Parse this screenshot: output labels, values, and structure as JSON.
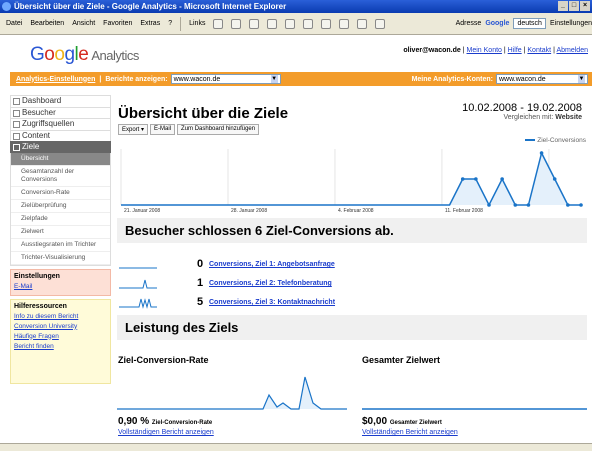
{
  "window": {
    "title": "Übersicht über die Ziele - Google Analytics - Microsoft Internet Explorer"
  },
  "menu": {
    "items": [
      "Datei",
      "Bearbeiten",
      "Ansicht",
      "Favoriten",
      "Extras",
      "?"
    ],
    "links_label": "Links",
    "address_label": "Adresse",
    "google_label": "Google",
    "google_field": "deutsch",
    "settings_label": "Einstellungen"
  },
  "header": {
    "logo_word": "Google",
    "logo_product": "Analytics",
    "user_email": "oliver@wacon.de",
    "links": [
      "Mein Konto",
      "Hilfe",
      "Kontakt",
      "Abmelden"
    ]
  },
  "orangebar": {
    "settings_link": "Analytics-Einstellungen",
    "reports_label": "Berichte anzeigen:",
    "reports_value": "www.wacon.de",
    "konten_label": "Meine Analytics-Konten:",
    "konten_value": "www.wacon.de"
  },
  "sidebar": {
    "items": [
      {
        "label": "Dashboard"
      },
      {
        "label": "Besucher"
      },
      {
        "label": "Zugriffsquellen"
      },
      {
        "label": "Content"
      },
      {
        "label": "Ziele"
      }
    ],
    "subitems": [
      "Übersicht",
      "Gesamtanzahl der Conversions",
      "Conversion-Rate",
      "Zielüberprüfung",
      "Zielpfade",
      "Zielwert",
      "Ausstiegsraten im Trichter",
      "Trichter-Visualisierung"
    ],
    "einst_title": "Einstellungen",
    "einst_link": "E-Mail",
    "hilfe_title": "Hilferessourcen",
    "hilfe_links": [
      "Info zu diesem Bericht",
      "Conversion University",
      "Häufige Fragen",
      "Bericht finden"
    ]
  },
  "main": {
    "title": "Übersicht über die Ziele",
    "date_range": "10.02.2008 - 19.02.2008",
    "compare_label": "Vergleichen mit:",
    "compare_value": "Website",
    "buttons": [
      "Export ▾",
      "E-Mail",
      "Zum Dashboard hinzufügen"
    ],
    "summary": "Besucher schlossen 6 Ziel-Conversions ab.",
    "leistung": "Leistung des Ziels",
    "rate_title": "Ziel-Conversion-Rate",
    "rate_value": "0,90 %",
    "rate_caption": "Ziel-Conversion-Rate",
    "value_title": "Gesamter Zielwert",
    "value_value": "$0,00",
    "value_caption": "Gesamter Zielwert",
    "full_report": "Vollständigen Bericht anzeigen"
  },
  "goals": [
    {
      "count": "0",
      "label": "Conversions, Ziel 1: Angebotsanfrage"
    },
    {
      "count": "1",
      "label": "Conversions, Ziel 2: Telefonberatung"
    },
    {
      "count": "5",
      "label": "Conversions, Ziel 3: Kontaktnachricht"
    }
  ],
  "chart_data": {
    "type": "line",
    "series": [
      {
        "name": "Ziel-Conversions",
        "values": [
          0,
          0,
          0,
          0,
          0,
          0,
          0,
          0,
          0,
          0,
          0,
          0,
          0,
          0,
          0,
          0,
          0,
          0,
          0,
          0,
          0,
          0,
          0,
          0,
          0,
          0,
          1,
          1,
          0,
          1,
          0,
          0,
          2,
          1,
          0,
          0
        ]
      }
    ],
    "x_tick_labels": [
      "21. Januar 2008",
      "28. Januar 2008",
      "4. Februar 2008",
      "11. Februar 2008"
    ]
  },
  "colors": {
    "accent": "#f39c2a",
    "line": "#1a74c8"
  }
}
